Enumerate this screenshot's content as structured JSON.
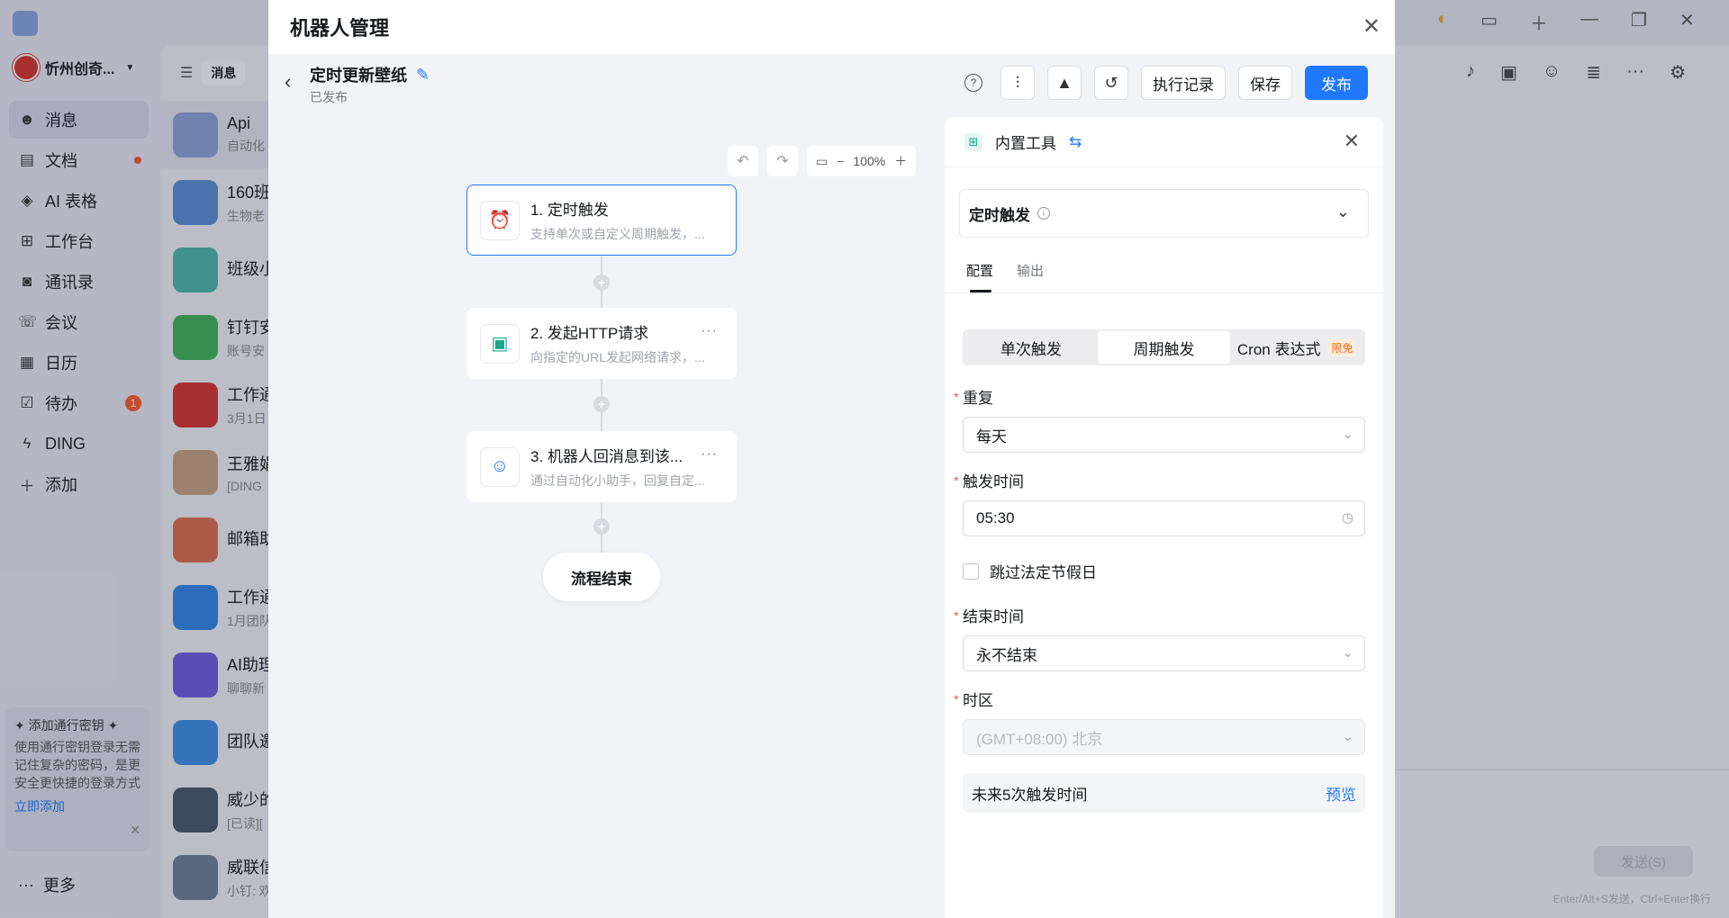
{
  "sidebar": {
    "org_name": "忻州创奇...",
    "items": [
      {
        "label": "消息",
        "icon": "chat-icon"
      },
      {
        "label": "文档",
        "icon": "document-icon"
      },
      {
        "label": "AI 表格",
        "icon": "cube-icon"
      },
      {
        "label": "工作台",
        "icon": "grid-icon"
      },
      {
        "label": "通讯录",
        "icon": "contacts-icon"
      },
      {
        "label": "会议",
        "icon": "phone-icon"
      },
      {
        "label": "日历",
        "icon": "calendar-icon"
      },
      {
        "label": "待办",
        "icon": "checkbox-icon",
        "badge": "1"
      },
      {
        "label": "DING",
        "icon": "lightning-icon"
      },
      {
        "label": "添加",
        "icon": "plus-icon"
      }
    ],
    "passkey": {
      "title": "添加通行密钥",
      "body": "使用通行密钥登录无需记住复杂的密码，是更安全更快捷的登录方式",
      "link": "立即添加"
    },
    "more_label": "更多"
  },
  "chatlist": {
    "tab_label": "消息",
    "items": [
      {
        "name": "Api",
        "sub": "自动化"
      },
      {
        "name": "160班",
        "sub": "生物老"
      },
      {
        "name": "班级小",
        "sub": ""
      },
      {
        "name": "钉钉安",
        "sub": "账号安"
      },
      {
        "name": "工作通",
        "sub": "3月1日"
      },
      {
        "name": "王雅娟",
        "sub": "[DING"
      },
      {
        "name": "邮箱助",
        "sub": ""
      },
      {
        "name": "工作通",
        "sub": "1月团队"
      },
      {
        "name": "AI助理",
        "sub": "聊聊新"
      },
      {
        "name": "团队邀",
        "sub": ""
      },
      {
        "name": "威少的",
        "sub": "[已读]["
      },
      {
        "name": "威联信",
        "sub": "小钉: 欢"
      }
    ]
  },
  "rightpane": {
    "send_label": "发送(S)",
    "hint": "Enter/Alt+S发送，Ctrl+Enter换行"
  },
  "modal": {
    "title": "机器人管理",
    "flow": {
      "name": "定时更新壁纸",
      "status": "已发布"
    },
    "toolbar": {
      "exec_log": "执行记录",
      "save": "保存",
      "publish": "发布"
    },
    "zoom": "100%",
    "nodes": [
      {
        "title": "1. 定时触发",
        "desc": "支持单次或自定义周期触发，..."
      },
      {
        "title": "2. 发起HTTP请求",
        "desc": "向指定的URL发起网络请求，..."
      },
      {
        "title": "3. 机器人回消息到该...",
        "desc": "通过自动化小助手，回复自定..."
      }
    ],
    "end_label": "流程结束"
  },
  "panel": {
    "header_title": "内置工具",
    "trigger_label": "定时触发",
    "tabs": [
      "配置",
      "输出"
    ],
    "segments": [
      "单次触发",
      "周期触发",
      "Cron 表达式"
    ],
    "segment_badge": "限免",
    "repeat_label": "重复",
    "repeat_value": "每天",
    "time_label": "触发时间",
    "time_value": "05:30",
    "skip_holiday_label": "跳过法定节假日",
    "end_label": "结束时间",
    "end_value": "永不结束",
    "tz_label": "时区",
    "tz_value": "(GMT+08:00) 北京",
    "preview_label": "未来5次触发时间",
    "preview_link": "预览"
  },
  "colors": {
    "primary": "#1f78ff",
    "accent_green": "#18a88b",
    "badge_orange": "#f26a1b",
    "required_red": "#ff4d4f"
  }
}
